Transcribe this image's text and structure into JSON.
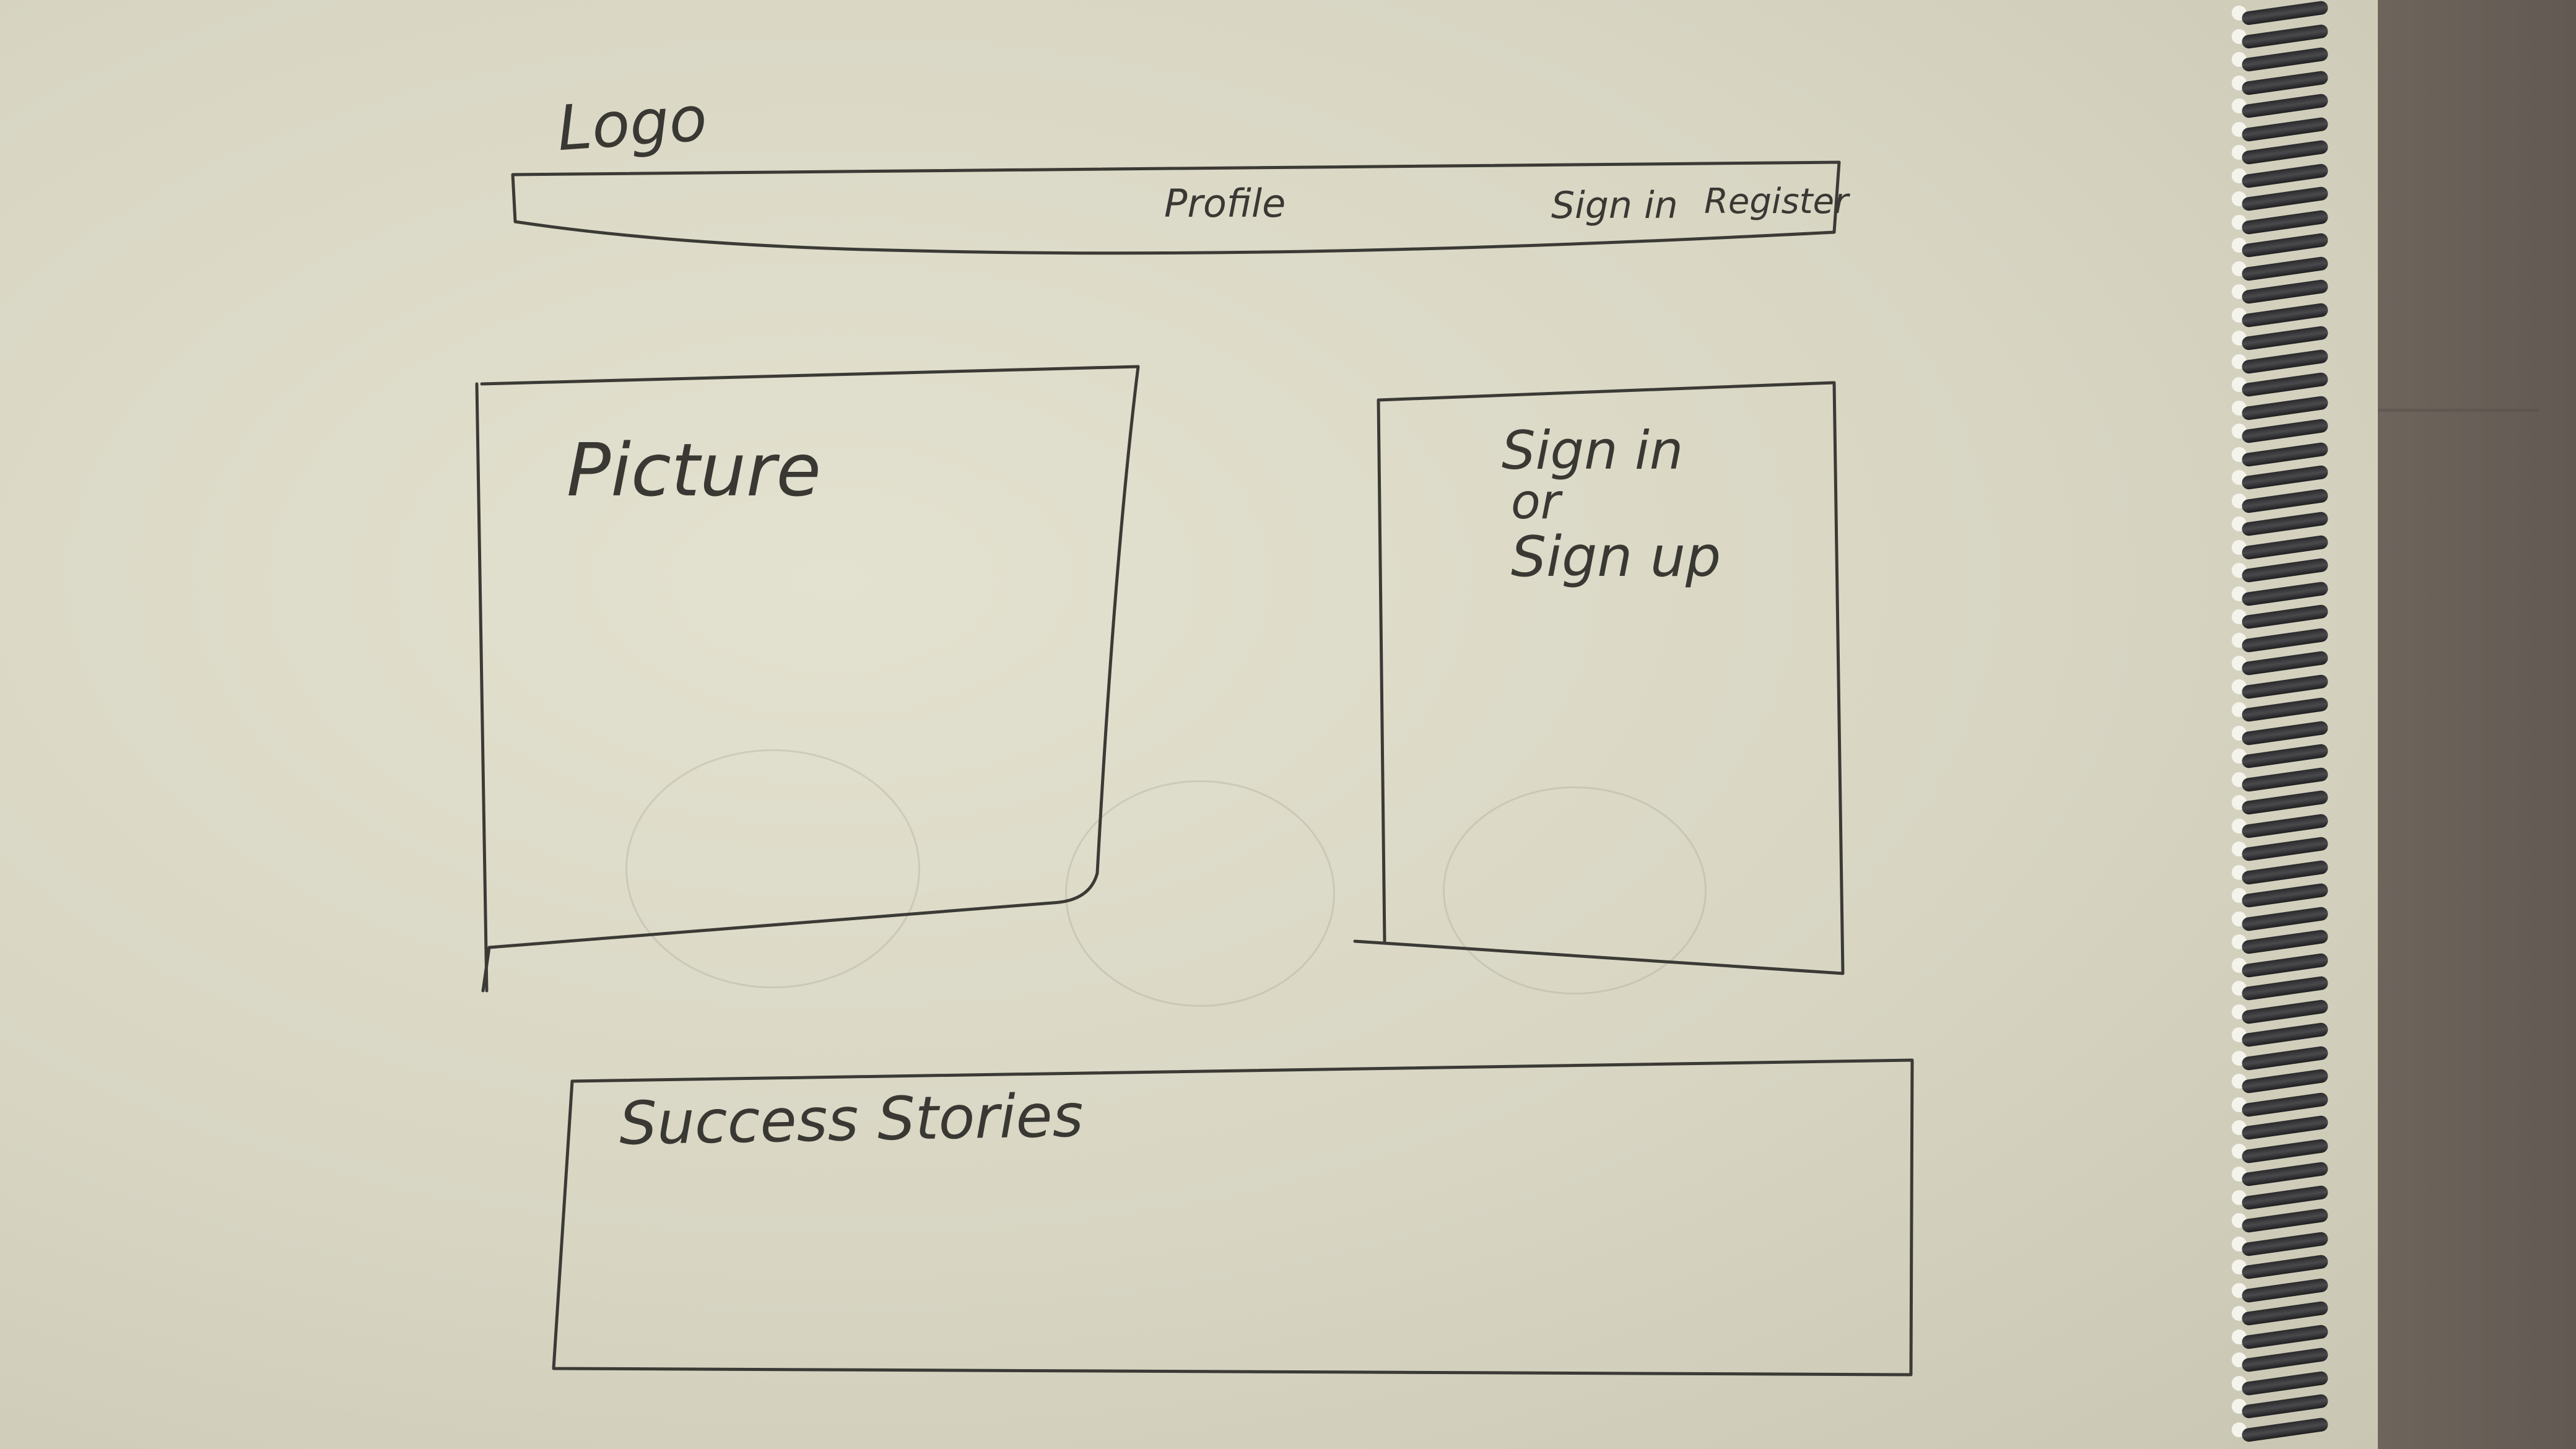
{
  "sketch": {
    "logo": "Logo",
    "nav": {
      "profile": "Profile",
      "sign_in": "Sign in",
      "register": "Register"
    },
    "hero": {
      "picture_label": "Picture"
    },
    "auth_panel": {
      "line1": "Sign in",
      "line2": "or",
      "line3": "Sign up"
    },
    "success": {
      "title": "Success Stories"
    }
  },
  "colors": {
    "paper": "#dcdac7",
    "ink": "#3a3833",
    "fabric": "#6e655d",
    "spiral": "#2f2f31"
  }
}
